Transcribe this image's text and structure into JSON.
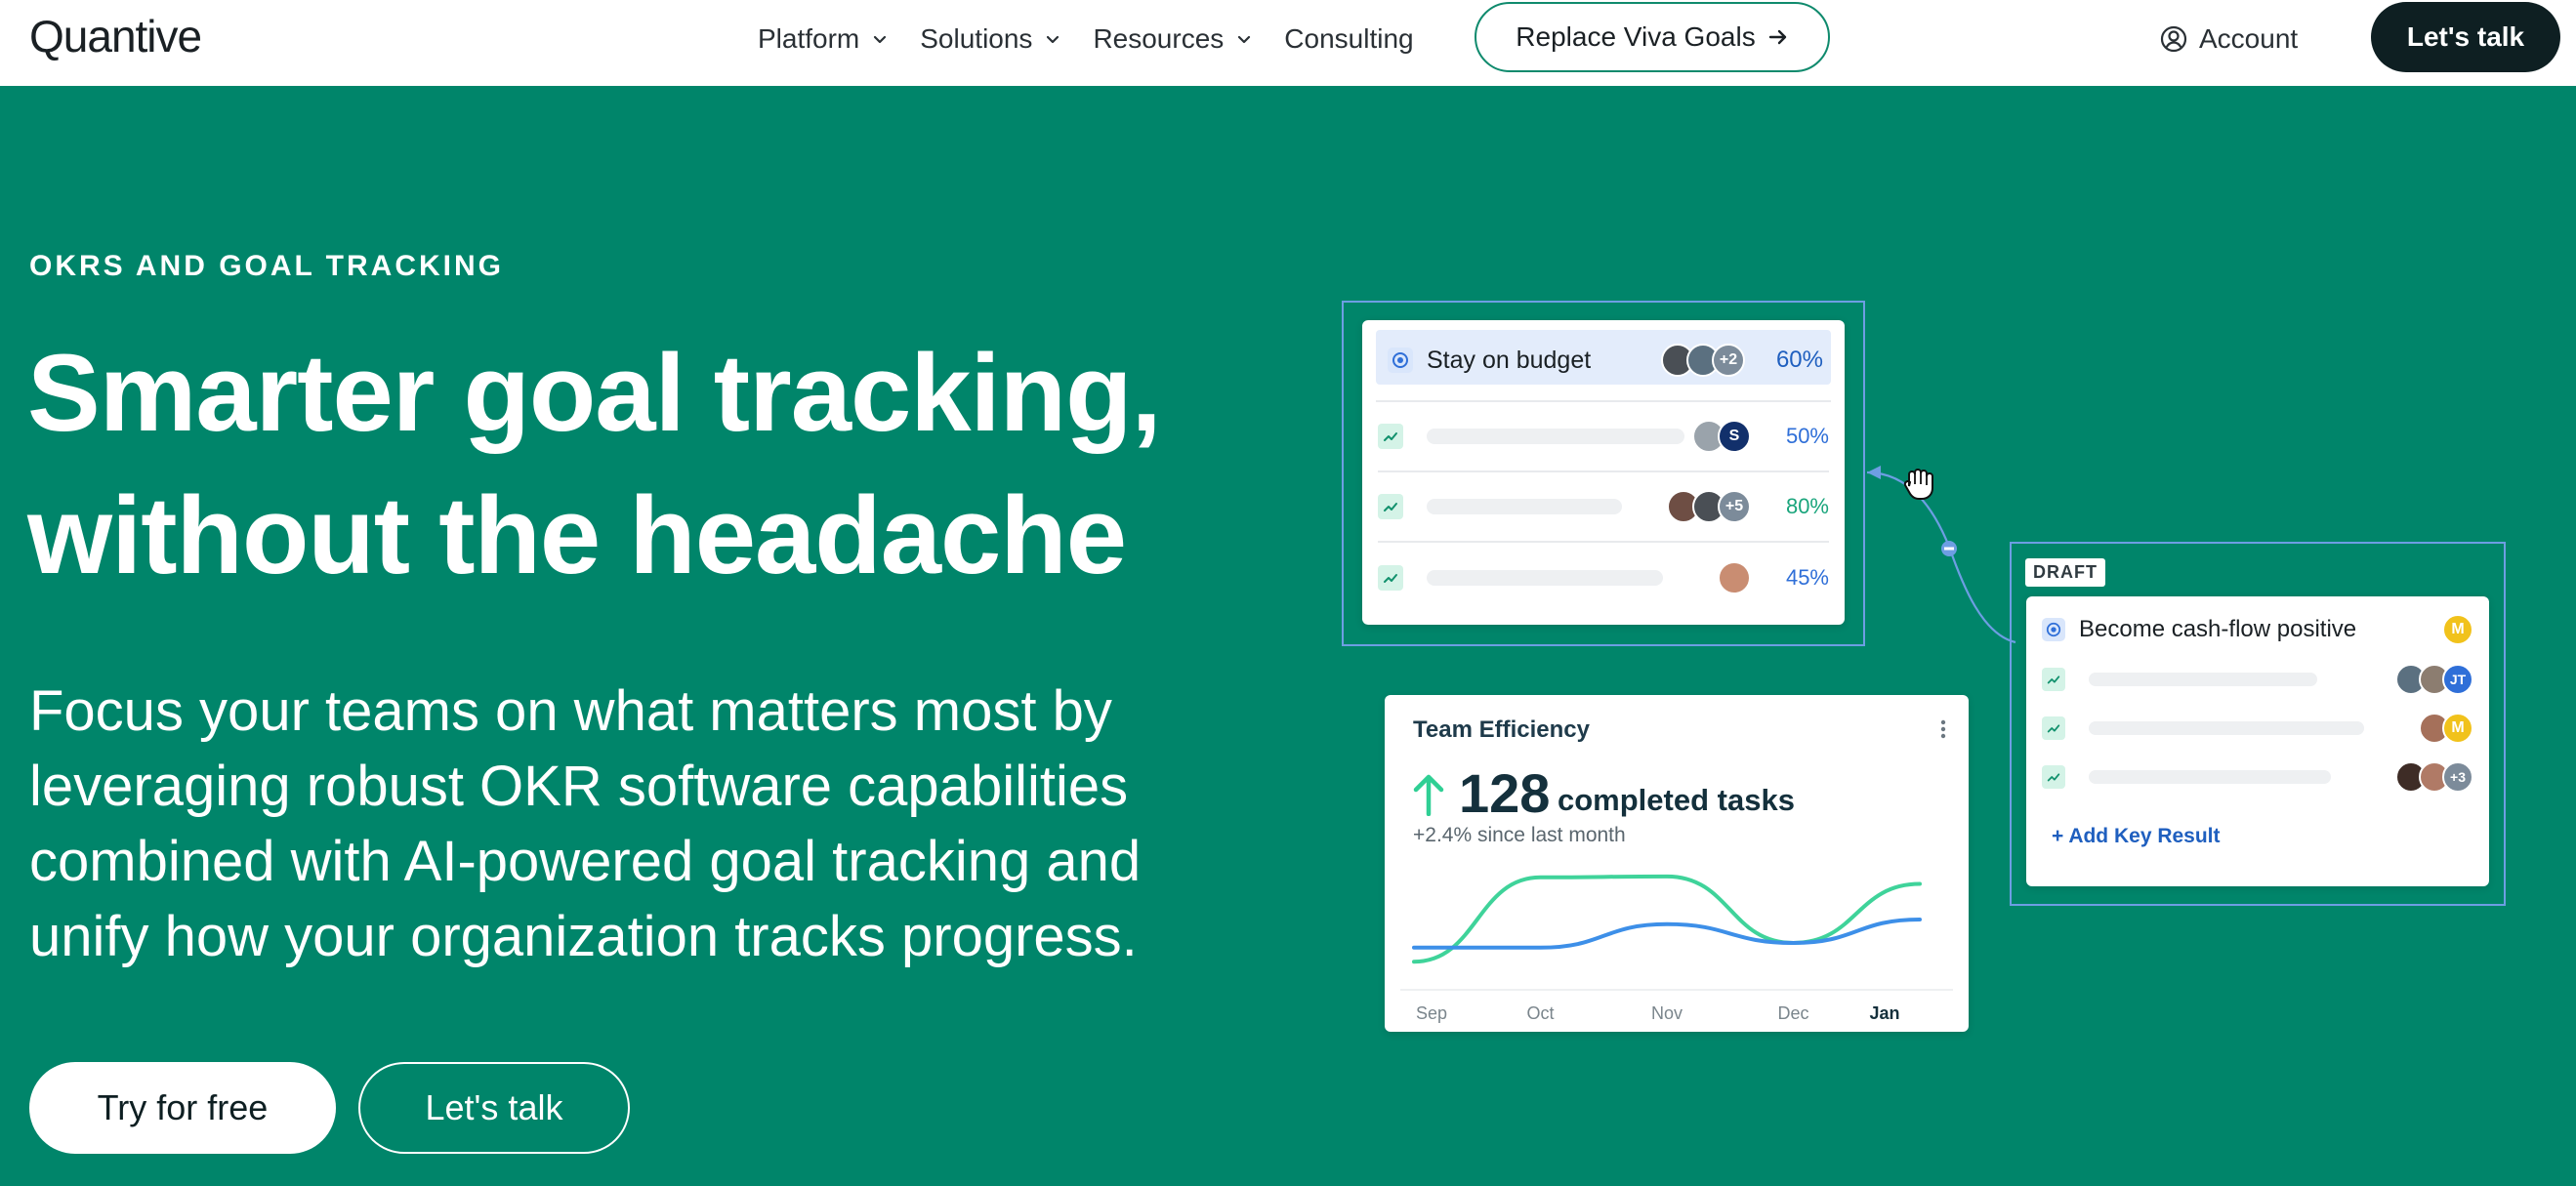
{
  "header": {
    "logo": "Quantive",
    "nav": [
      {
        "label": "Platform",
        "dropdown": true
      },
      {
        "label": "Solutions",
        "dropdown": true
      },
      {
        "label": "Resources",
        "dropdown": true
      },
      {
        "label": "Consulting",
        "dropdown": false
      }
    ],
    "replace_button": "Replace Viva Goals",
    "account": "Account",
    "talk_button": "Let's talk"
  },
  "hero": {
    "eyebrow": "OKRS AND GOAL TRACKING",
    "headline_line1": "Smarter goal tracking,",
    "headline_line2": "without the headache",
    "subtext": "Focus your teams on what matters most by leveraging robust OKR software capabilities combined with AI-powered goal tracking and unify how your organization tracks progress.",
    "primary_cta": "Try for free",
    "secondary_cta": "Let's talk"
  },
  "budget_card": {
    "objective": {
      "title": "Stay on budget",
      "extra_count": "+2",
      "progress": "60%"
    },
    "key_results": [
      {
        "progress": "50%",
        "avatar_initials": [
          "S"
        ]
      },
      {
        "progress": "80%",
        "extra_count": "+5"
      },
      {
        "progress": "45%"
      }
    ]
  },
  "draft_card": {
    "tag": "DRAFT",
    "objective": {
      "title": "Become cash-flow positive",
      "owner_initial": "M"
    },
    "key_results": [
      {
        "avatar_initials": [
          "JT"
        ]
      },
      {
        "avatar_initials": [
          "M"
        ]
      },
      {
        "extra_count": "+3"
      }
    ],
    "add_link": "+ Add Key Result"
  },
  "efficiency_card": {
    "title": "Team Efficiency",
    "value": "128",
    "value_label": "completed tasks",
    "delta": "+2.4% since last month",
    "menu_icon": "more-vertical-icon"
  },
  "chart_data": {
    "type": "line",
    "title": "",
    "categories": [
      "Sep",
      "Oct",
      "Nov",
      "Dec",
      "Jan"
    ],
    "highlighted_category": "Jan",
    "series": [
      {
        "color": "#3fd39a",
        "values": [
          0.05,
          0.95,
          0.96,
          0.25,
          0.88
        ]
      },
      {
        "color": "#3d8fe8",
        "values": [
          0.2,
          0.2,
          0.45,
          0.25,
          0.5
        ]
      }
    ],
    "y_axis_visible": false,
    "grid": true
  },
  "colors": {
    "brand_green": "#00856A",
    "dark_button": "#0e1f22",
    "link_blue": "#1f5fbf",
    "selection_blue": "#6d9ee3"
  }
}
